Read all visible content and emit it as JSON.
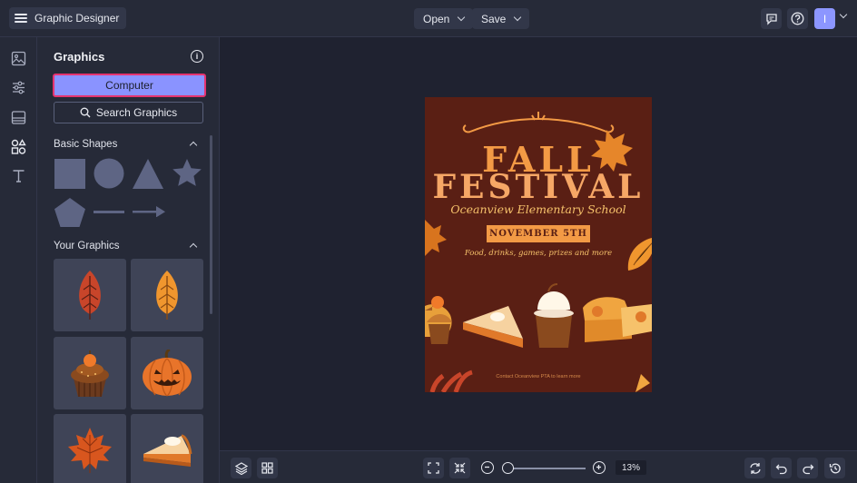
{
  "app": {
    "title": "Graphic Designer"
  },
  "toolbar": {
    "open_label": "Open",
    "save_label": "Save",
    "avatar_initial": "I"
  },
  "panel": {
    "title": "Graphics",
    "computer_label": "Computer",
    "search_label": "Search Graphics",
    "basic_shapes_label": "Basic Shapes",
    "your_graphics_label": "Your Graphics"
  },
  "poster": {
    "title_line1": "FALL",
    "title_line2": "FESTIVAL",
    "subtitle": "Oceanview Elementary School",
    "date": "NOVEMBER 5TH",
    "details": "Food, drinks, games, prizes and more",
    "contact": "Contact Oceanview PTA to learn more"
  },
  "zoom": {
    "level": "13%"
  },
  "colors": {
    "accent": "#8a93ff",
    "highlight": "#e5336f",
    "poster_bg": "#5a1f14",
    "poster_orange": "#f39a45"
  },
  "icons": [
    "menu-icon",
    "chevron-down-icon",
    "comment-icon",
    "help-icon",
    "image-icon",
    "sliders-icon",
    "layout-icon",
    "shapes-icon",
    "text-icon",
    "info-icon",
    "search-icon",
    "layers-icon",
    "grid-icon",
    "fit-icon",
    "shrink-icon",
    "zoom-out-icon",
    "zoom-in-icon",
    "rotate-icon",
    "undo-icon",
    "redo-icon",
    "history-icon"
  ]
}
